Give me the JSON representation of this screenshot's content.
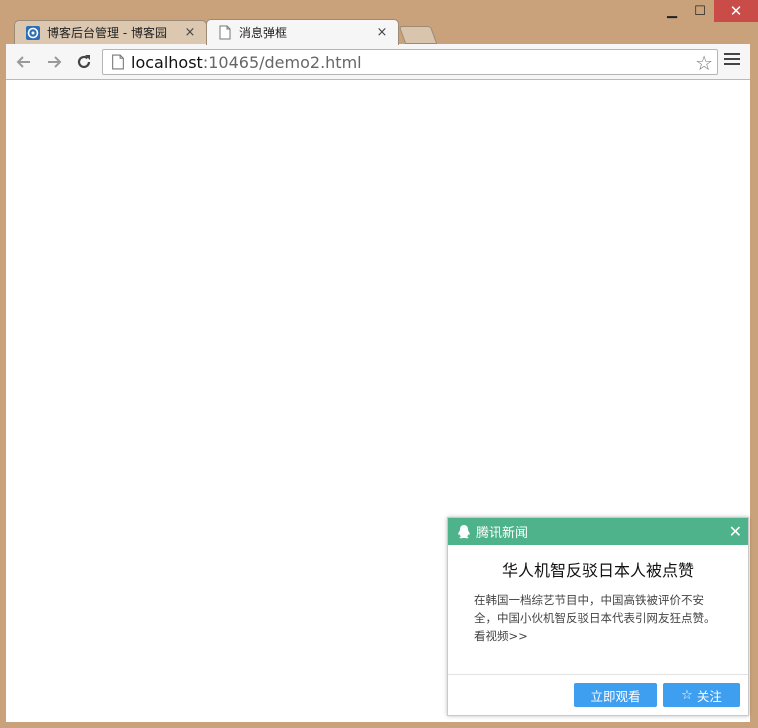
{
  "window": {
    "minimize": "▁",
    "maximize": "☐",
    "close": "✕"
  },
  "tabs": [
    {
      "label": "博客后台管理 - 博客园",
      "close": "×"
    },
    {
      "label": "消息弹框",
      "close": "×"
    }
  ],
  "omnibox": {
    "host": "localhost",
    "rest": ":10465/demo2.html"
  },
  "popup": {
    "source": "腾讯新闻",
    "close": "✕",
    "title": "华人机智反驳日本人被点赞",
    "body": "在韩国一档综艺节目中，中国高铁被评价不安全，中国小伙机智反驳日本代表引网友狂点赞。看视频>>",
    "watch_button": "立即观看",
    "follow_button": "关注",
    "header_color": "#4eb38a",
    "button_color": "#3e9ef0"
  }
}
